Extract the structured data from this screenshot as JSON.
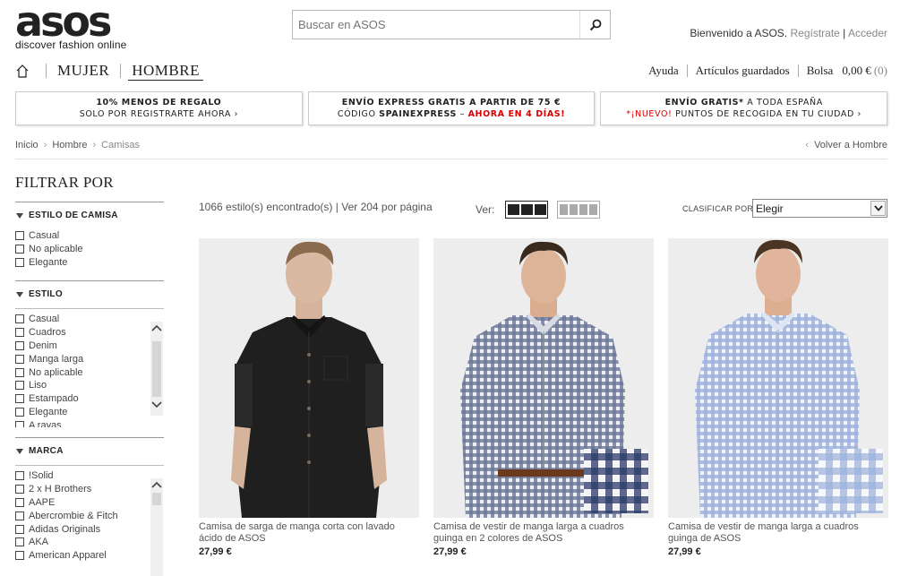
{
  "brand": {
    "logo_text": "asos",
    "tagline": "discover fashion online"
  },
  "search": {
    "placeholder": "Buscar en ASOS"
  },
  "account": {
    "welcome": "Bienvenido a ASOS.",
    "register": "Regístrate",
    "login": "Acceder"
  },
  "nav": {
    "women": "MUJER",
    "men": "HOMBRE"
  },
  "utility": {
    "help": "Ayuda",
    "saved": "Artículos guardados",
    "bag": "Bolsa",
    "bag_total": "0,00 €",
    "bag_count": "(0)"
  },
  "promos": [
    {
      "line1": "10% MENOS DE REGALO",
      "line2": "SOLO POR REGISTRARTE AHORA ›"
    },
    {
      "line1": "ENVÍO EXPRESS GRATIS A PARTIR DE 75 €",
      "line2_a": "CÓDIGO",
      "line2_b": "SPAINEXPRESS",
      "line2_c": "–",
      "line2_d": "AHORA EN 4 DÍAS!"
    },
    {
      "line1_a": "ENVÍO GRATIS*",
      "line1_b": "A TODA ESPAÑA",
      "line2_a": "*¡NUEVO!",
      "line2_b": "PUNTOS DE RECOGIDA EN TU CIUDAD ›"
    }
  ],
  "breadcrumb": [
    "Inicio",
    "Hombre",
    "Camisas"
  ],
  "back_link": "Volver a Hombre",
  "filters": {
    "title": "FILTRAR POR",
    "groups": [
      {
        "title": "ESTILO DE CAMISA",
        "options": [
          "Casual",
          "No aplicable",
          "Elegante"
        ]
      },
      {
        "title": "ESTILO",
        "options": [
          "Casual",
          "Cuadros",
          "Denim",
          "Manga larga",
          "No aplicable",
          "Liso",
          "Estampado",
          "Elegante",
          "A rayas"
        ]
      },
      {
        "title": "MARCA",
        "options": [
          "!Solid",
          "2 x H Brothers",
          "AAPE",
          "Abercrombie & Fitch",
          "Adidas Originals",
          "AKA",
          "American Apparel"
        ]
      }
    ]
  },
  "toolbar": {
    "count_text": "1066 estilo(s) encontrado(s)",
    "sep": "|",
    "per_page": "Ver 204 por página",
    "view_label": "Ver:",
    "sort_label": "CLASIFICAR POR",
    "sort_value": "Elegir"
  },
  "products": [
    {
      "name": "Camisa de sarga de manga corta con lavado ácido de ASOS",
      "price": "27,99 €"
    },
    {
      "name": "Camisa de vestir de manga larga a cuadros guinga en 2 colores de ASOS",
      "price": "27,99 €"
    },
    {
      "name": "Camisa de vestir de manga larga a cuadros guinga de ASOS",
      "price": "27,99 €"
    }
  ],
  "colors": {
    "accent_red": "#dd0000",
    "text": "#333333"
  }
}
